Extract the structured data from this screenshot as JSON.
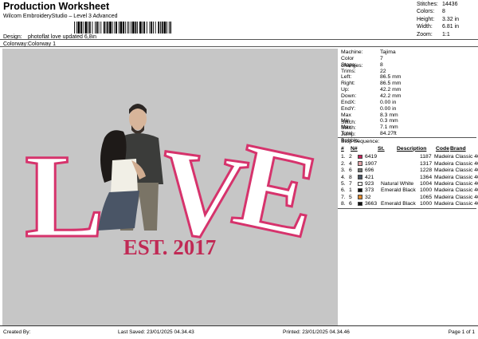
{
  "header": {
    "title": "Production Worksheet",
    "subtitle": "Wilcom EmbroideryStudio – Level 3 Advanced",
    "design_label": "Design:",
    "design_value": "photoflat love updated 6,8in",
    "colorway_label": "Colorway:",
    "colorway_value": "Colorway 1"
  },
  "summary": [
    {
      "label": "Stitches:",
      "value": "14436"
    },
    {
      "label": "Colors:",
      "value": "8"
    },
    {
      "label": "Height:",
      "value": "3.32 in"
    },
    {
      "label": "Width:",
      "value": "6.81 in"
    },
    {
      "label": "Zoom:",
      "value": "1:1"
    }
  ],
  "design": {
    "letter_l": "L",
    "letter_v": "V",
    "letter_e": "E",
    "est_text": "EST. 2017",
    "colors": {
      "pink": "#d6336c",
      "pink_fill": "#ffffff",
      "est": "#c02a55"
    }
  },
  "machine": [
    {
      "label": "Machine:",
      "value": "Tajima"
    },
    {
      "label": "Color changes:",
      "value": "7"
    },
    {
      "label": "Stops:",
      "value": "8"
    },
    {
      "label": "Trims:",
      "value": "22"
    },
    {
      "label": "Left:",
      "value": "86.5 mm"
    },
    {
      "label": "Right:",
      "value": "86.5 mm"
    },
    {
      "label": "Up:",
      "value": "42.2 mm"
    },
    {
      "label": "Down:",
      "value": "42.2 mm"
    },
    {
      "label": "EndX:",
      "value": "0.00 in"
    },
    {
      "label": "EndY:",
      "value": "0.00 in"
    },
    {
      "label": "Max Stitch:",
      "value": "8.3 mm"
    },
    {
      "label": "Min Stitch:",
      "value": "0.3 mm"
    },
    {
      "label": "Max Jump:",
      "value": "7.1 mm"
    },
    {
      "label": "Total Bobbin:",
      "value": "84.27ft"
    }
  ],
  "stop_sequence": {
    "title": "Stop Sequence:",
    "headers": [
      "#",
      "N#",
      "St.",
      "Description",
      "Code",
      "Brand"
    ],
    "rows": [
      {
        "num": "1.",
        "n": "2",
        "color": "#c8245c",
        "st": "6419",
        "desc": "",
        "code": "1187",
        "brand": "Madeira Classic 40"
      },
      {
        "num": "2.",
        "n": "4",
        "color": "#e2a2a6",
        "st": "1907",
        "desc": "",
        "code": "1317",
        "brand": "Madeira Classic 40"
      },
      {
        "num": "3.",
        "n": "6",
        "color": "#6f7472",
        "st": "696",
        "desc": "",
        "code": "1228",
        "brand": "Madeira Classic 40"
      },
      {
        "num": "4.",
        "n": "8",
        "color": "#4b5565",
        "st": "421",
        "desc": "",
        "code": "1364",
        "brand": "Madeira Classic 40"
      },
      {
        "num": "5.",
        "n": "7",
        "color": "#f4f4f0",
        "st": "923",
        "desc": "Natural White",
        "code": "1004",
        "brand": "Madeira Classic 40"
      },
      {
        "num": "6.",
        "n": "1",
        "color": "#111111",
        "st": "373",
        "desc": "Emerald Black",
        "code": "1000",
        "brand": "Madeira Classic 40"
      },
      {
        "num": "7.",
        "n": "5",
        "color": "#e0892e",
        "st": "32",
        "desc": "",
        "code": "1065",
        "brand": "Madeira Classic 40"
      },
      {
        "num": "8.",
        "n": "6",
        "color": "#111111",
        "st": "3663",
        "desc": "Emerald Black",
        "code": "1000",
        "brand": "Madeira Classic 40"
      }
    ]
  },
  "footer": {
    "created_by": "Created By:",
    "last_saved": "Last Saved: 23/01/2025 04.34.43",
    "printed": "Printed: 23/01/2025 04.34.46",
    "page": "Page 1 of 1"
  }
}
